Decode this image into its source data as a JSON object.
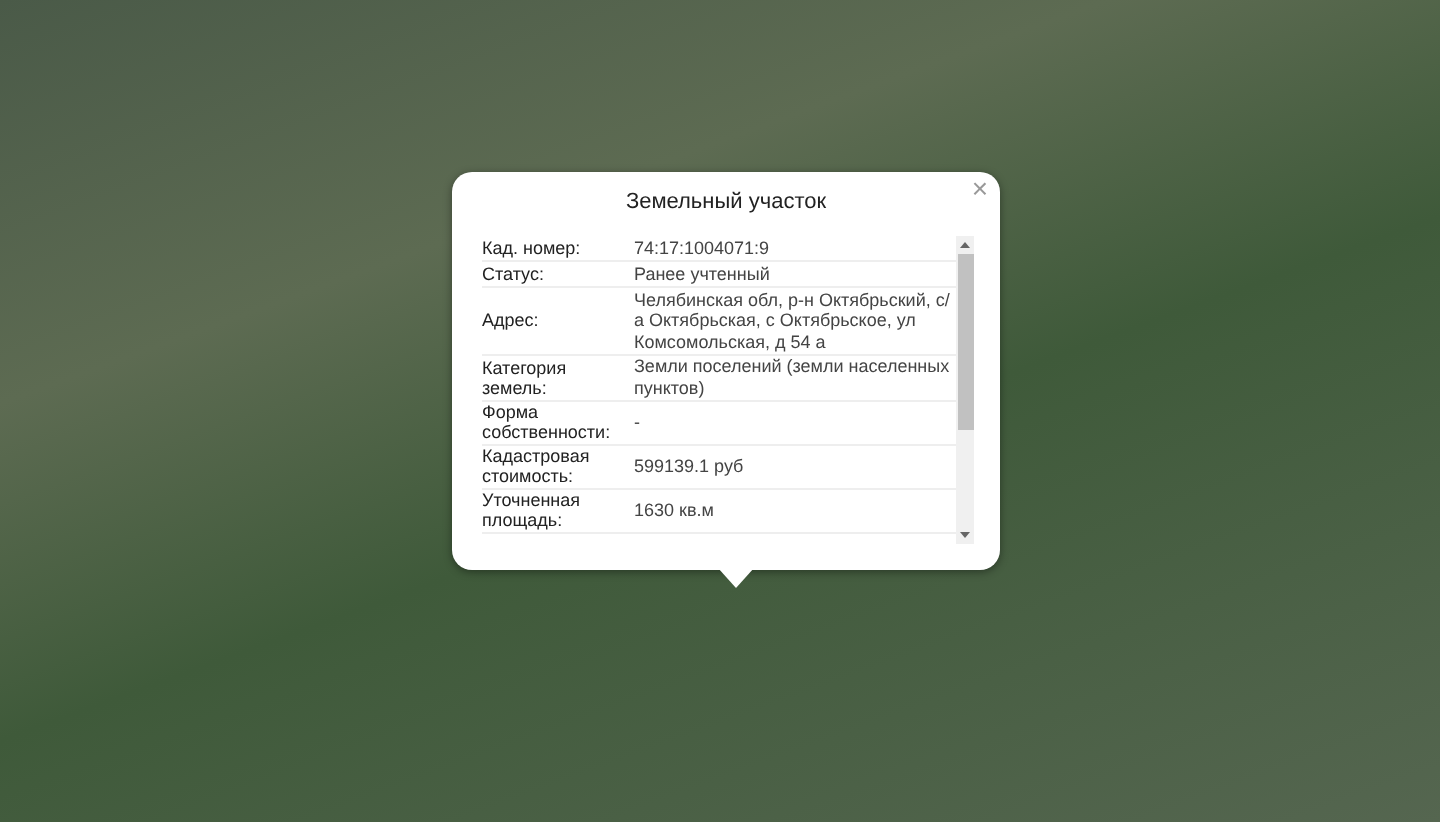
{
  "popup": {
    "title": "Земельный участок",
    "close": "×",
    "rows": [
      {
        "label": "Кад. номер:",
        "value": "74:17:1004071:9"
      },
      {
        "label": "Статус:",
        "value": "Ранее учтенный"
      },
      {
        "label": "Адрес:",
        "value": "Челябинская обл, р-н Октябрьский, с/а Октябрьская, с Октябрьское, ул Комсомольская, д 54 а"
      },
      {
        "label": "Категория земель:",
        "value": "Земли поселений (земли населенных пунктов)"
      },
      {
        "label": "Форма собственности:",
        "value": "-"
      },
      {
        "label": "Кадастровая стоимость:",
        "value": "599139.1 руб"
      },
      {
        "label": "Уточненная площадь:",
        "value": "1630 кв.м"
      }
    ]
  }
}
